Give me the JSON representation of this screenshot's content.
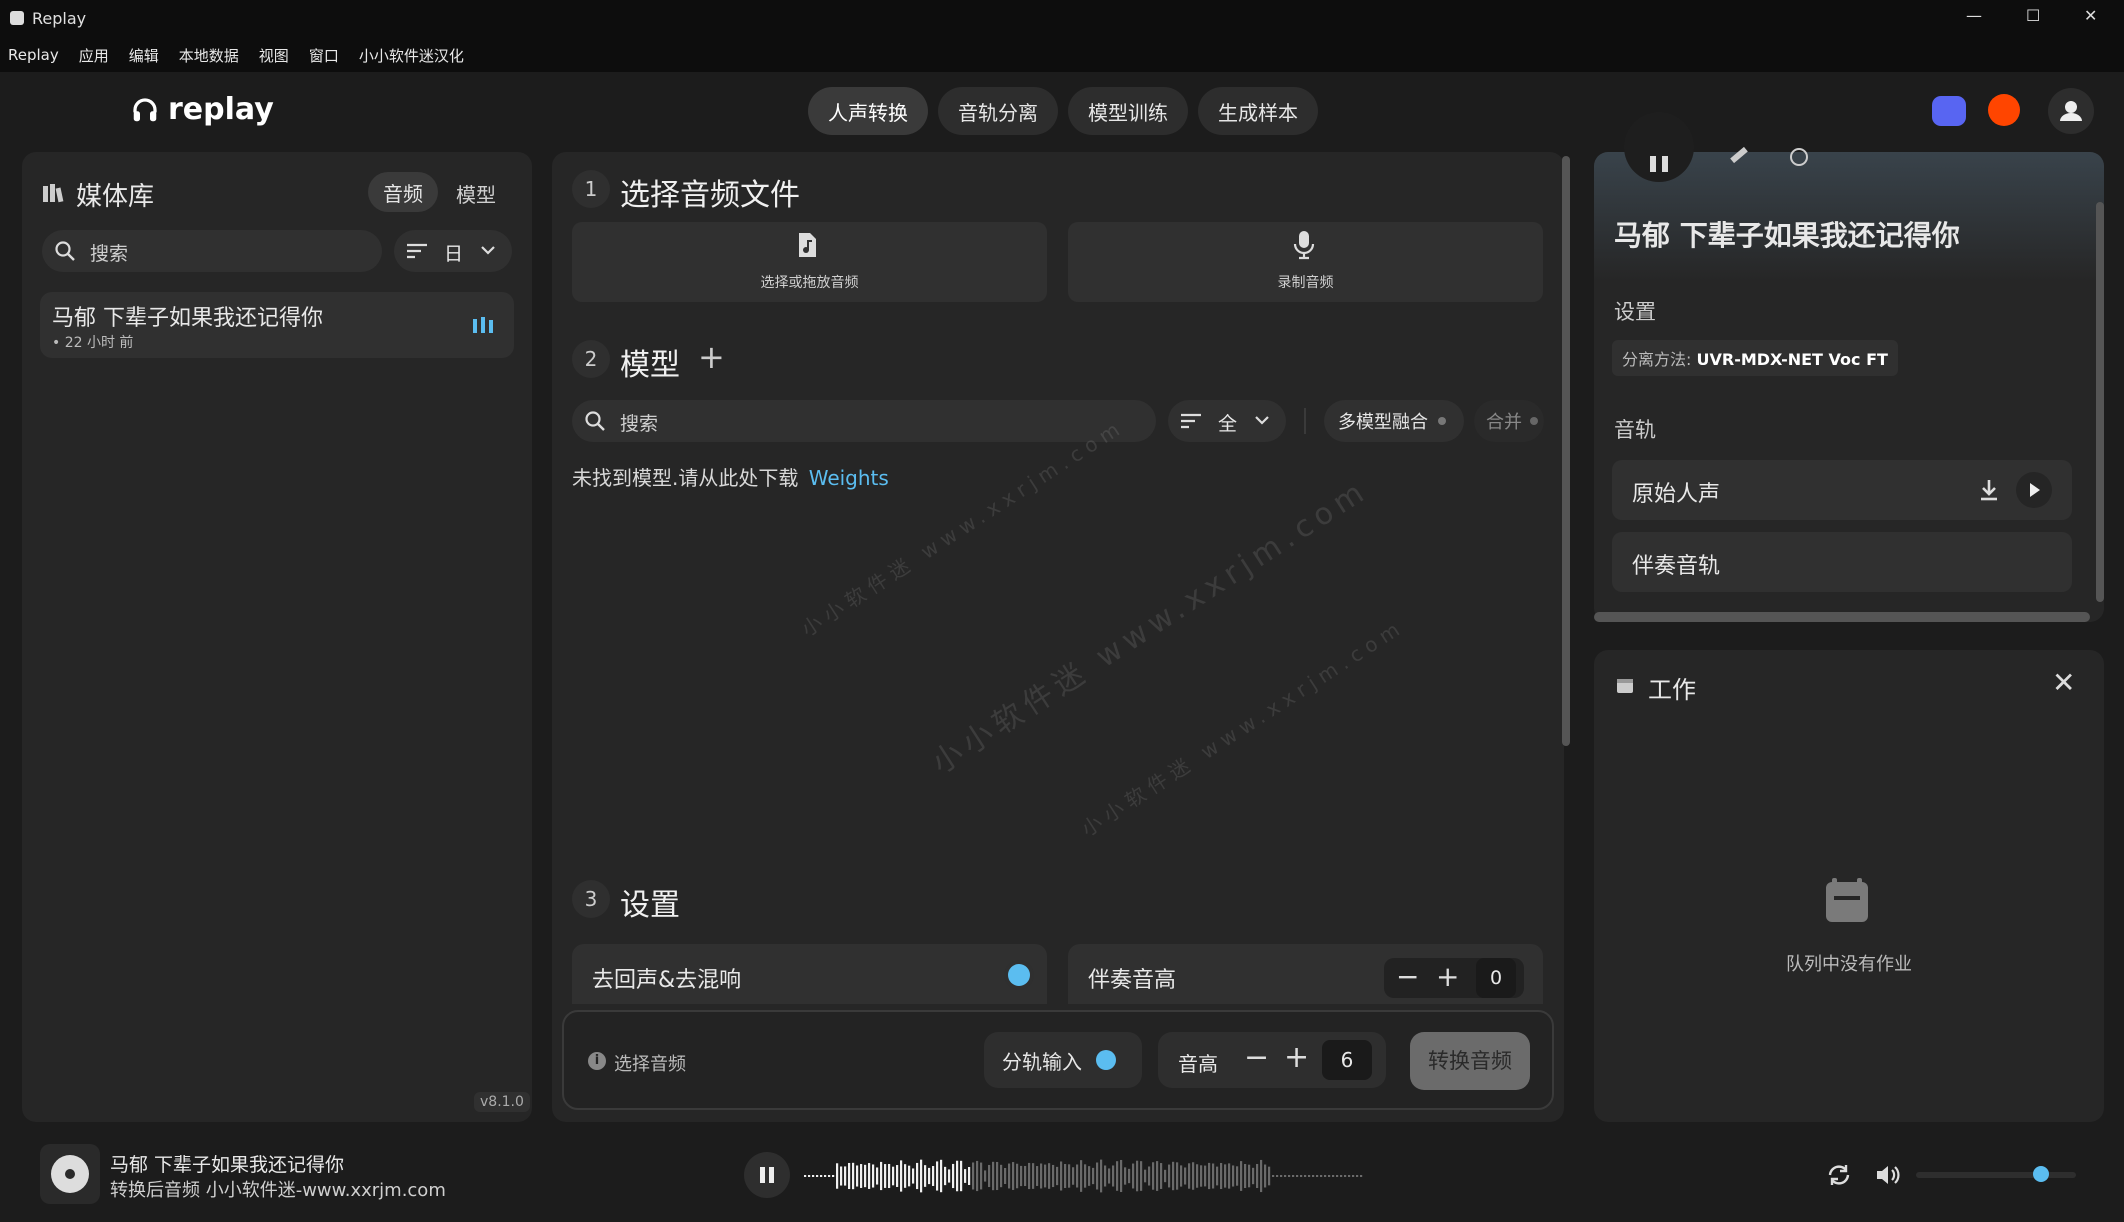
{
  "window": {
    "title": "Replay",
    "controls": [
      "—",
      "☐",
      "✕"
    ]
  },
  "menu": [
    "Replay",
    "应用",
    "编辑",
    "本地数据",
    "视图",
    "窗口",
    "小小软件迷汉化"
  ],
  "brand": {
    "logo_text": "replay"
  },
  "nav_tabs": [
    "人声转换",
    "音轨分离",
    "模型训练",
    "生成样本"
  ],
  "library": {
    "title": "媒体库",
    "tabs": [
      "音频",
      "模型"
    ],
    "search_placeholder": "搜索",
    "sort_label": "日",
    "item": {
      "title": "马郁 下辈子如果我还记得你",
      "subtitle": "• 22 小时 前"
    },
    "version": "v8.1.0"
  },
  "step1": {
    "num": "1",
    "title": "选择音频文件",
    "pick_label": "选择或拖放音频",
    "record_label": "录制音频"
  },
  "step2": {
    "num": "2",
    "title": "模型",
    "add": "+",
    "search_placeholder": "搜索",
    "filter_label": "全",
    "multi_label": "多模型融合",
    "merge_label": "合并",
    "empty_text": "未找到模型.请从此处下载",
    "link_text": "Weights"
  },
  "step3": {
    "num": "3",
    "title": "设置",
    "dereverb_label": "去回声&去混响",
    "pitch_label": "伴奏音高",
    "pitch_value": "0"
  },
  "action_bar": {
    "select_audio": "选择音频",
    "split_input": "分轨输入",
    "pitch_label": "音高",
    "pitch_value": "6",
    "convert": "转换音频"
  },
  "detail": {
    "title": "马郁 下辈子如果我还记得你",
    "settings_label": "设置",
    "method_prefix": "分离方法:",
    "method_value": "UVR-MDX-NET Voc FT",
    "tracks_label": "音轨",
    "tracks": [
      "原始人声",
      "伴奏音轨"
    ]
  },
  "jobs": {
    "title": "工作",
    "empty": "队列中没有作业"
  },
  "player": {
    "title": "马郁 下辈子如果我还记得你",
    "subtitle": "转换后音频 小小软件迷-www.xxrjm.com",
    "volume": 0.78
  },
  "watermarks": [
    "小小软件迷 www.xxrjm.com",
    "小小软件迷 www.xxrjm.com",
    "小小软件迷 www.xxrjm.com"
  ],
  "colors": {
    "accent": "#5bbdf0",
    "bg": "#1c1c1c",
    "panel": "#262626",
    "discord": "#5865f2",
    "reddit": "#ff4500"
  }
}
